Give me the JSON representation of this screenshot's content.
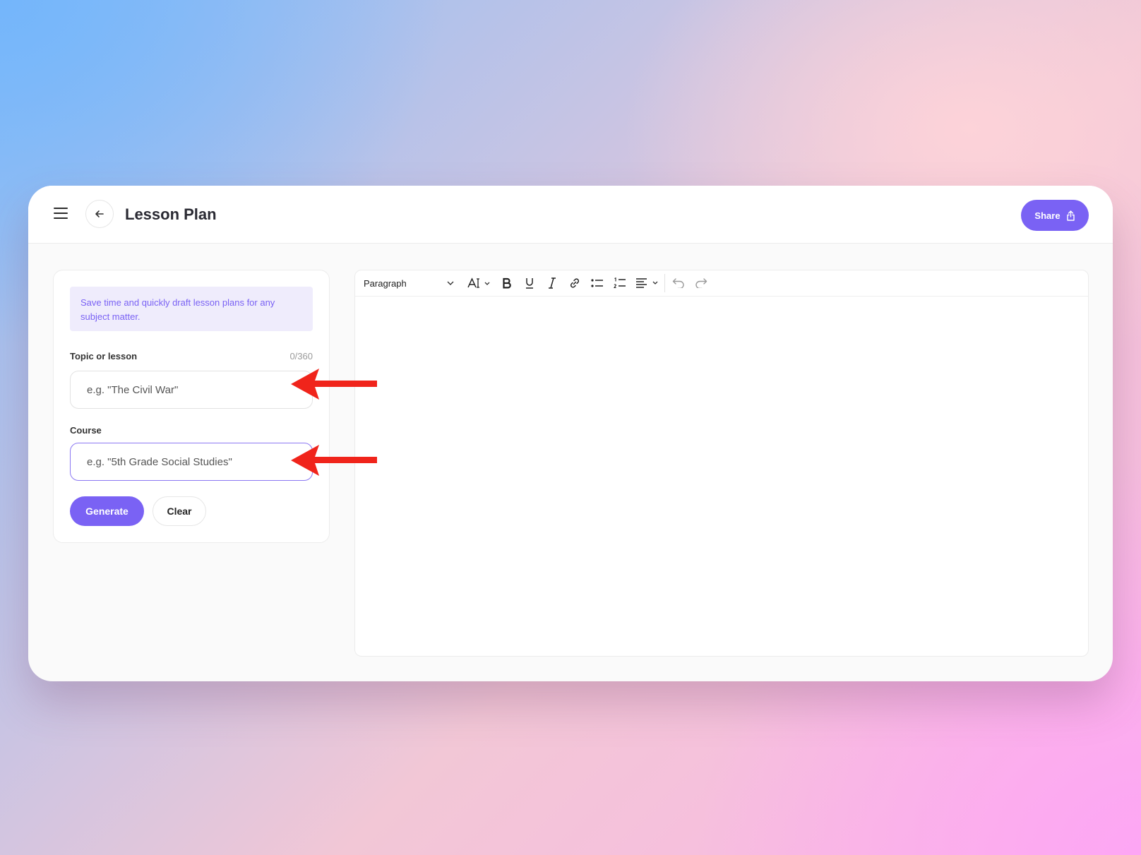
{
  "header": {
    "title": "Lesson Plan",
    "share_label": "Share"
  },
  "form": {
    "info_text": "Save time and quickly draft lesson plans for any subject matter.",
    "topic": {
      "label": "Topic or lesson",
      "counter": "0/360",
      "placeholder": "e.g. \"The Civil War\"",
      "value": ""
    },
    "course": {
      "label": "Course",
      "placeholder": "e.g. \"5th Grade Social Studies\"",
      "value": ""
    },
    "generate_label": "Generate",
    "clear_label": "Clear"
  },
  "editor": {
    "block_type": "Paragraph",
    "toolbar_icons": [
      "font-size-icon",
      "bold-icon",
      "underline-icon",
      "italic-icon",
      "link-icon",
      "bullet-list-icon",
      "numbered-list-icon",
      "align-icon",
      "undo-icon",
      "redo-icon"
    ],
    "content": ""
  },
  "colors": {
    "accent": "#7a62f4",
    "info_background": "#efecfc",
    "annotation_arrow": "#f0241b"
  }
}
